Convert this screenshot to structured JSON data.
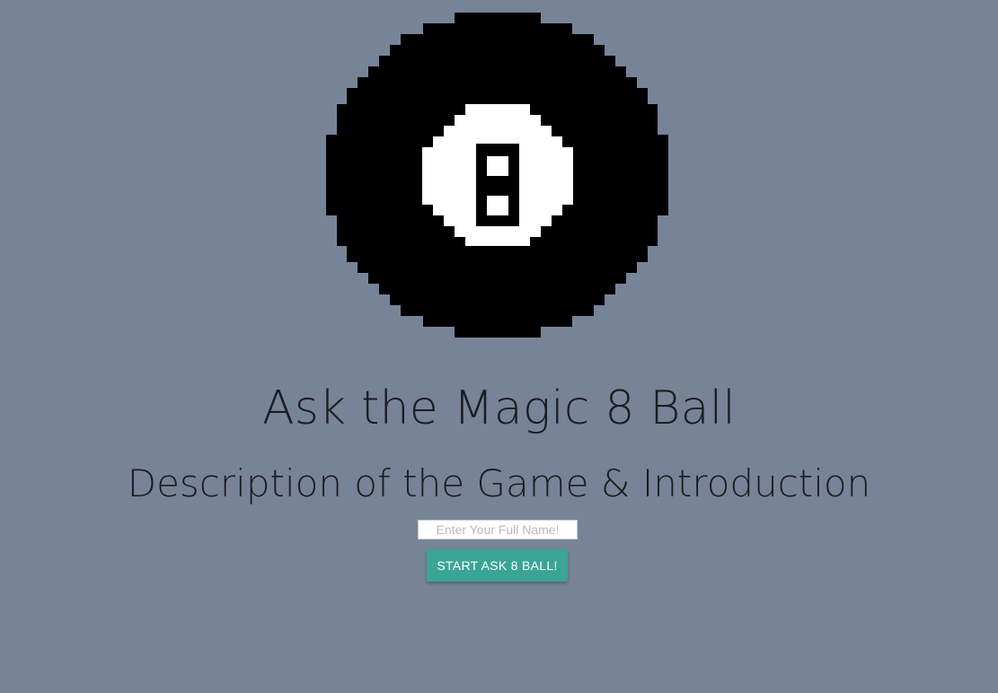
{
  "logo": {
    "icon": "eight-ball-icon",
    "digit": "8"
  },
  "header": {
    "title": "Ask the Magic 8 Ball",
    "subtitle": "Description of the Game & Introduction"
  },
  "form": {
    "name_value": "",
    "name_placeholder": "Enter Your Full Name!",
    "start_label": "START ASK 8 BALL!"
  },
  "colors": {
    "background": "#778497",
    "button": "#3aa597",
    "ball": "#000000",
    "ball_window": "#ffffff"
  }
}
